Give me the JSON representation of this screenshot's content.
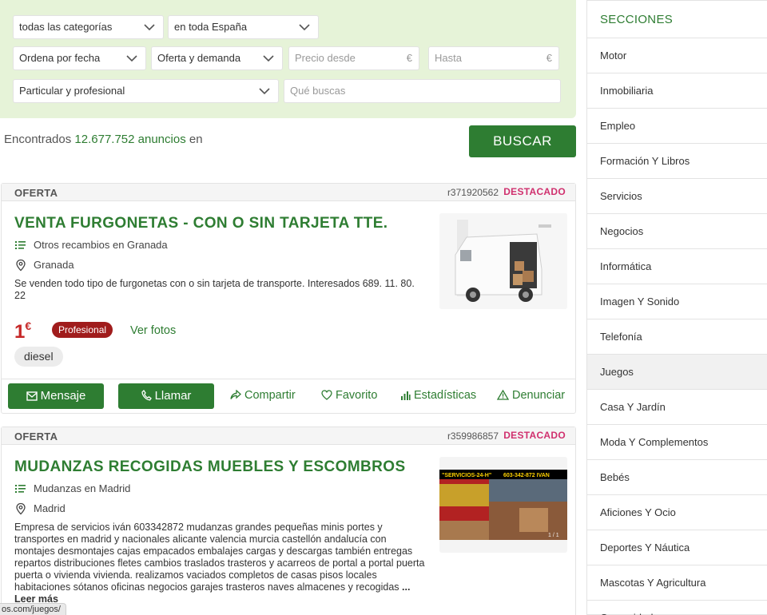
{
  "filters": {
    "category": "todas las categorías",
    "location": "en toda España",
    "order": "Ordena por fecha",
    "offer": "Oferta y demanda",
    "price_from_placeholder": "Precio desde",
    "price_to_placeholder": "Hasta",
    "currency": "€",
    "seller": "Particular y profesional",
    "query_placeholder": "Qué buscas"
  },
  "results": {
    "prefix": "Encontrados",
    "count": "12.677.752 anuncios",
    "suffix": "en",
    "search_button": "BUSCAR"
  },
  "listings": [
    {
      "type": "OFERTA",
      "ref": "r371920562",
      "featured": "DESTACADO",
      "title": "VENTA FURGONETAS - CON O SIN TARJETA TTE.",
      "category": "Otros recambios en Granada",
      "location": "Granada",
      "description": "Se venden todo tipo de furgonetas con o sin tarjeta de transporte. Interesados 689. 11. 80. 22",
      "price": "1",
      "price_currency": "€",
      "badge": "Profesional",
      "photos_link": "Ver fotos",
      "tag": "diesel",
      "image_icon": "van-photo"
    },
    {
      "type": "OFERTA",
      "ref": "r359986857",
      "featured": "DESTACADO",
      "title": "MUDANZAS RECOGIDAS MUEBLES Y ESCOMBROS",
      "category": "Mudanzas en Madrid",
      "location": "Madrid",
      "description": "Empresa de servicios iván 603342872 mudanzas grandes pequeñas minis portes y transportes en madrid y nacionales alicante valencia murcia castellón andalucía con montajes desmontajes cajas empacados embalajes cargas y descargas también entregas repartos distribuciones fletes cambios traslados trasteros y acarreos de portal a portal puerta puerta o vivienda vivienda. realizamos vaciados completos de casas pisos locales habitaciones sótanos oficinas negocios garajes trasteros naves almacenes y recogidas",
      "more": "... Leer más",
      "image_text_1": "\"SERVICIOS-24-H\"",
      "image_text_2": "603-342-872  IVAN",
      "image_counter": "1 / 1"
    }
  ],
  "actions": {
    "message": "Mensaje",
    "call": "Llamar",
    "share": "Compartir",
    "favorite": "Favorito",
    "stats": "Estadísticas",
    "report": "Denunciar"
  },
  "sidebar": {
    "title": "SECCIONES",
    "items": [
      "Motor",
      "Inmobiliaria",
      "Empleo",
      "Formación Y Libros",
      "Servicios",
      "Negocios",
      "Informática",
      "Imagen Y Sonido",
      "Telefonía",
      "Juegos",
      "Casa Y Jardín",
      "Moda Y Complementos",
      "Bebés",
      "Aficiones Y Ocio",
      "Deportes Y Náutica",
      "Mascotas Y Agricultura",
      "Comunidad"
    ],
    "active_item": "Juegos"
  },
  "status_url": "os.com/juegos/",
  "colors": {
    "accent_green": "#2e7d32",
    "panel_bg": "#e6f3d8",
    "featured_pink": "#d0306e",
    "price_red": "#c62828",
    "badge_red": "#a01c1c"
  }
}
